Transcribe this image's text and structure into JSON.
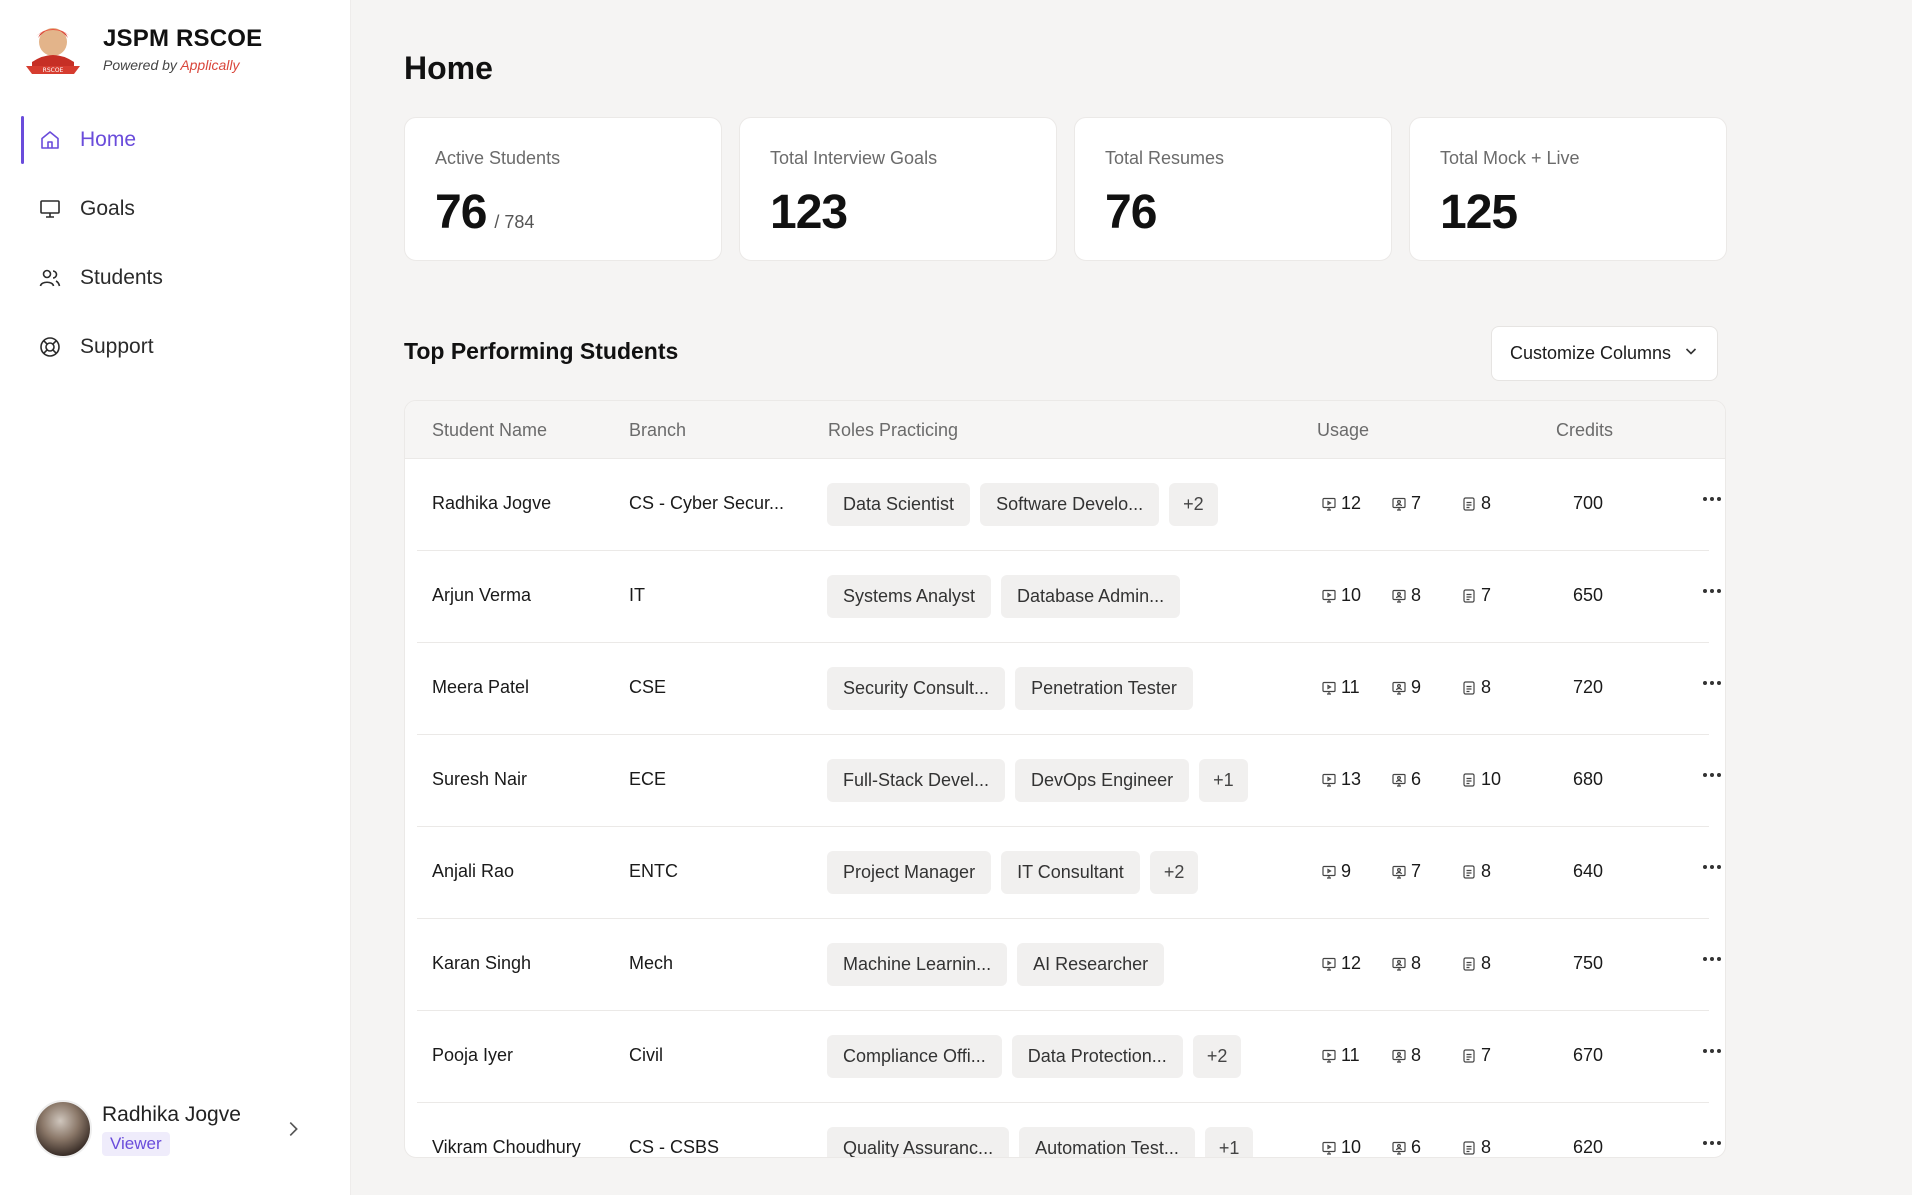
{
  "brand": {
    "title": "JSPM RSCOE",
    "powered_by": "Powered by",
    "powered_name": "Applically",
    "logo_text": "RSCOE"
  },
  "nav": [
    {
      "label": "Home",
      "icon": "home-icon",
      "active": true
    },
    {
      "label": "Goals",
      "icon": "monitor-icon",
      "active": false
    },
    {
      "label": "Students",
      "icon": "users-icon",
      "active": false
    },
    {
      "label": "Support",
      "icon": "lifebuoy-icon",
      "active": false
    }
  ],
  "user": {
    "name": "Radhika Jogve",
    "role": "Viewer"
  },
  "page": {
    "title": "Home"
  },
  "stats": [
    {
      "label": "Active Students",
      "value": "76",
      "denom": "/ 784"
    },
    {
      "label": "Total Interview Goals",
      "value": "123",
      "denom": ""
    },
    {
      "label": "Total Resumes",
      "value": "76",
      "denom": ""
    },
    {
      "label": "Total Mock + Live",
      "value": "125",
      "denom": ""
    }
  ],
  "section": {
    "title": "Top Performing Students",
    "customize_label": "Customize Columns"
  },
  "table": {
    "headers": {
      "name": "Student Name",
      "branch": "Branch",
      "roles": "Roles Practicing",
      "usage": "Usage",
      "credits": "Credits"
    },
    "rows": [
      {
        "name": "Radhika Jogve",
        "branch": "CS - Cyber Secur...",
        "roles": [
          "Data Scientist",
          "Software Develo..."
        ],
        "more": "+2",
        "usage": [
          "12",
          "7",
          "8"
        ],
        "credits": "700"
      },
      {
        "name": "Arjun Verma",
        "branch": "IT",
        "roles": [
          "Systems Analyst",
          "Database Admin..."
        ],
        "more": "",
        "usage": [
          "10",
          "8",
          "7"
        ],
        "credits": "650"
      },
      {
        "name": "Meera Patel",
        "branch": "CSE",
        "roles": [
          "Security Consult...",
          "Penetration Tester"
        ],
        "more": "",
        "usage": [
          "11",
          "9",
          "8"
        ],
        "credits": "720"
      },
      {
        "name": "Suresh Nair",
        "branch": "ECE",
        "roles": [
          "Full-Stack Devel...",
          "DevOps Engineer"
        ],
        "more": "+1",
        "usage": [
          "13",
          "6",
          "10"
        ],
        "credits": "680"
      },
      {
        "name": "Anjali Rao",
        "branch": "ENTC",
        "roles": [
          "Project Manager",
          "IT Consultant"
        ],
        "more": "+2",
        "usage": [
          "9",
          "7",
          "8"
        ],
        "credits": "640"
      },
      {
        "name": "Karan Singh",
        "branch": "Mech",
        "roles": [
          "Machine Learnin...",
          "AI Researcher"
        ],
        "more": "",
        "usage": [
          "12",
          "8",
          "8"
        ],
        "credits": "750"
      },
      {
        "name": "Pooja Iyer",
        "branch": "Civil",
        "roles": [
          "Compliance Offi...",
          "Data Protection..."
        ],
        "more": "+2",
        "usage": [
          "11",
          "8",
          "7"
        ],
        "credits": "670"
      },
      {
        "name": "Vikram Choudhury",
        "branch": "CS - CSBS",
        "roles": [
          "Quality Assuranc...",
          "Automation Test..."
        ],
        "more": "+1",
        "usage": [
          "10",
          "6",
          "8"
        ],
        "credits": "620"
      }
    ]
  },
  "colors": {
    "accent": "#6a4cdb",
    "brand_red": "#d9453a",
    "chip_bg": "#f1f0ef",
    "page_bg": "#f5f4f3"
  }
}
